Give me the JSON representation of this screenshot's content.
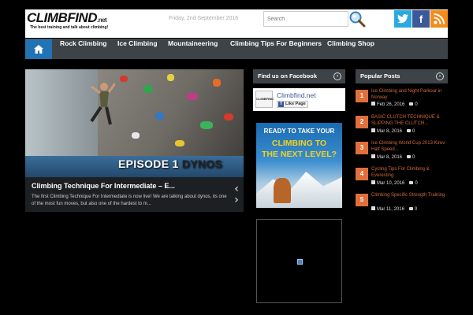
{
  "header": {
    "logo_text": "CLIMBFIND",
    "logo_suffix": ".net",
    "tagline": "The best training and talk about climbing!",
    "date": "Friday, 2nd September 2016",
    "search_placeholder": "Search"
  },
  "social": {
    "twitter": "t",
    "facebook": "f",
    "rss": "∷"
  },
  "nav": {
    "items": [
      {
        "label": "Rock Climbing"
      },
      {
        "label": "Ice Climbing"
      },
      {
        "label": "Mountaineering"
      },
      {
        "label": "Climbing Tips For Beginners"
      },
      {
        "label": "Climbing Shop"
      }
    ]
  },
  "slider": {
    "overlay_1": "EPISODE 1",
    "overlay_2": "DYNOS",
    "title": "Climbing Technique For Intermediate – E...",
    "excerpt": "The first Climbing Technique For Intermediate is now live! We are talking about dynos, its one of the most fun moves, but also one of the hardest to m..."
  },
  "facebook_widget": {
    "heading": "Find us on Facebook",
    "thumb_label": "CLIMBFIND",
    "page_name": "Climbfind.net",
    "like_label": "Like Page"
  },
  "ad": {
    "line1": "READY TO TAKE YOUR",
    "line2": "CLIMBING TO",
    "line3": "THE NEXT LEVEL?"
  },
  "popular": {
    "heading": "Popular Posts",
    "items": [
      {
        "num": "1",
        "title": "Ice Climbing and Night Parkour in Norway",
        "date": "Feb 26, 2016",
        "comments": "0"
      },
      {
        "num": "2",
        "title": "BASIC CLUTCH TECHNIQUE & SLIPPING THE CLUTCH...",
        "date": "Mar 8, 2016",
        "comments": "0"
      },
      {
        "num": "3",
        "title": "Ice Climbing World Cup 2013 Kirov Half Speed...",
        "date": "Mar 8, 2016",
        "comments": "0"
      },
      {
        "num": "4",
        "title": "Cycling Tips For Climbing & Everesting",
        "date": "Mar 10, 2016",
        "comments": "0"
      },
      {
        "num": "5",
        "title": "Climbing Specific Strength Training",
        "date": "Mar 11, 2016",
        "comments": "0"
      }
    ]
  },
  "colors": {
    "nav_bg": "#3d4347",
    "home_blue": "#2173b3",
    "accent_orange": "#e06f3b"
  }
}
